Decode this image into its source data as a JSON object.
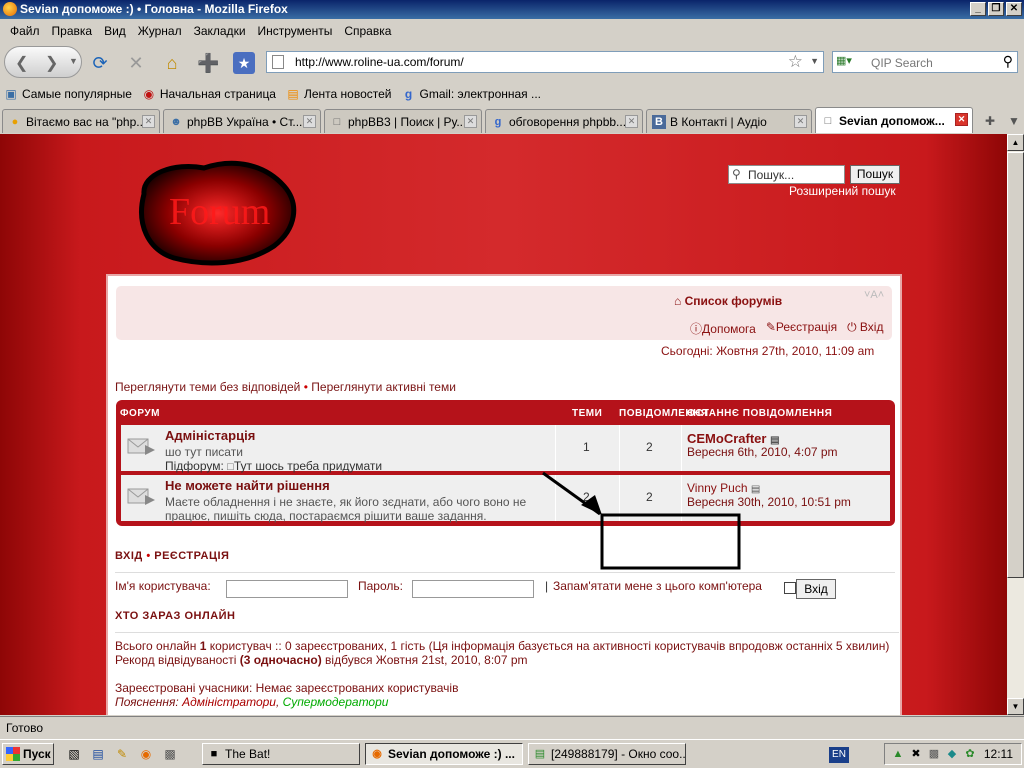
{
  "window": {
    "title": "Sevian допоможе :) • Головна - Mozilla Firefox",
    "minimize": "_",
    "restore": "❐",
    "close": "✕"
  },
  "menu": [
    "Файл",
    "Правка",
    "Вид",
    "Журнал",
    "Закладки",
    "Инструменты",
    "Справка"
  ],
  "toolbar": {
    "url": "http://www.roline-ua.com/forum/",
    "search_placeholder": "QIP Search"
  },
  "bookmarks": [
    {
      "label": "Самые популярные",
      "icon": "bookmarks-icon"
    },
    {
      "label": "Начальная страница",
      "icon": "firefox-icon"
    },
    {
      "label": "Лента новостей",
      "icon": "rss-icon"
    },
    {
      "label": "Gmail: электронная ...",
      "icon": "google-icon"
    }
  ],
  "tabs": [
    {
      "label": "Вітаємо вас на \"php...",
      "icon": "page-icon"
    },
    {
      "label": "phpBB Україна • Ст...",
      "icon": "phpbb-icon"
    },
    {
      "label": "phpBB3 | Поиск | Ру...",
      "icon": "page-icon"
    },
    {
      "label": "обговорення phpbb...",
      "icon": "google-icon"
    },
    {
      "label": "В Контакті | Аудіо",
      "icon": "vk-icon"
    },
    {
      "label": "Sevian допомож...",
      "icon": "page-icon",
      "active": true
    }
  ],
  "forum": {
    "logo_text": "Forum",
    "search_placeholder": "Пошук...",
    "search_button": "Пошук",
    "advanced_search": "Розширений пошук",
    "forums_list": "Список форумів",
    "font_size": "˅A˄",
    "help": "Допомога",
    "register": "Реєстрація",
    "login": "Вхід",
    "today": "Сьогодні: Жовтня 27th, 2010, 11:09 am",
    "unanswered": "Переглянути теми без відповідей",
    "bullet": "•",
    "active_topics": "Переглянути активні теми",
    "headers": {
      "forum": "ФОРУМ",
      "topics": "ТЕМИ",
      "posts": "ПОВІДОМЛЕННЯ",
      "last_post": "ОСТАННЄ ПОВІДОМЛЕННЯ"
    },
    "rows": [
      {
        "title": "Адміністарція",
        "desc": "шо тут писати",
        "subforum_label": "Підфорум:",
        "subforum": "Тут шось треба придумати",
        "topics": "1",
        "posts": "2",
        "last_user": "СЕМоСrafter",
        "last_date": "Вересня 6th, 2010, 4:07 pm"
      },
      {
        "title": "Не можете найти рішення",
        "desc": "Маєте обладнення і не знаєте, як його зєднати, або чого воно не працює, пишіть сюда, постараємся рішити ваше задання.",
        "topics": "2",
        "posts": "2",
        "last_user": "Vinny Puch",
        "last_date": "Вересня 30th, 2010, 10:51 pm"
      }
    ],
    "login_head": "ВХІД",
    "login_sep": "•",
    "register_head": "РЕЄСТРАЦІЯ",
    "username_label": "Ім'я користувача:",
    "password_label": "Пароль:",
    "remember_sep": "|",
    "remember_label": "Запам'ятати мене з цього комп'ютера",
    "login_button": "Вхід",
    "online_head": "ХТО ЗАРАЗ ОНЛАЙН",
    "online_total_pre": "Всього онлайн ",
    "online_total_num": "1",
    "online_total_post": " користувач :: 0 зареєстрованих, 1 гість (Ця інформація базується на активності користувачів впродовж останніх 5 хвилин)",
    "record_pre": "Рекорд відвідуваності ",
    "record_bold": "(3 одночасно)",
    "record_post": " відбувся Жовтня 21st, 2010, 8:07 pm",
    "registered": "Зареєстровані учасники: Немає зареєстрованих користувачів",
    "legend_label": "Пояснення:",
    "legend_admins": "Адміністратори",
    "legend_comma": ",",
    "legend_mods": "Супермодератори"
  },
  "status": "Готово",
  "taskbar": {
    "start": "Пуск",
    "tasks": [
      {
        "label": "The Bat!",
        "icon": "bat-icon"
      },
      {
        "label": "Sevian допоможе :) ...",
        "icon": "firefox-icon",
        "active": true
      },
      {
        "label": "[249888179] - Окно соо...",
        "icon": "chat-icon"
      }
    ],
    "lang": "EN",
    "clock": "12:11"
  },
  "colors": {
    "forum_bg": "#c8191c",
    "forum_accent": "#7a1010",
    "admins": "#aa0000",
    "mods": "#00aa00"
  }
}
